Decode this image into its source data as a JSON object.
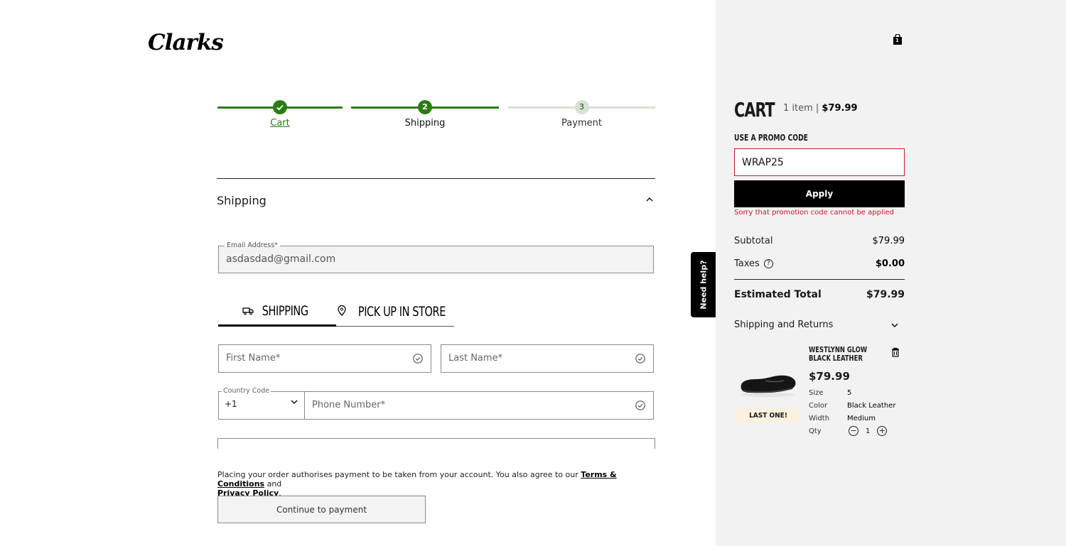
{
  "brand": {
    "logo_text": "Clarks"
  },
  "steps": [
    {
      "num": "",
      "label": "Cart",
      "state": "done"
    },
    {
      "num": "2",
      "label": "Shipping",
      "state": "current"
    },
    {
      "num": "3",
      "label": "Payment",
      "state": "pending"
    }
  ],
  "shipping_section": {
    "title": "Shipping"
  },
  "form": {
    "email": {
      "label": "Email Address*",
      "value": "asdasdad@gmail.com"
    },
    "tabs": [
      {
        "label": "SHIPPING",
        "icon": "truck-icon"
      },
      {
        "label": "PICK UP IN STORE",
        "icon": "location-pin-icon"
      }
    ],
    "first_name": {
      "placeholder": "First Name*"
    },
    "last_name": {
      "placeholder": "Last Name*"
    },
    "country_code": {
      "label": "Country Code",
      "value": "+1"
    },
    "phone": {
      "placeholder": "Phone Number*"
    }
  },
  "legal": {
    "text_before": "Placing your order authorises payment to be taken from your account. You also agree to our ",
    "terms": "Terms & Conditions",
    "text_mid": " and",
    "privacy": "Privacy Policy",
    "text_end": "."
  },
  "continue_label": "Continue to payment",
  "need_help": "Need help?",
  "cart": {
    "bag_count": "1",
    "title": "CART",
    "items_text": "1 item | ",
    "total_inline": "$79.99",
    "promo_label": "USE A PROMO CODE",
    "promo_value": "WRAP25",
    "apply_label": "Apply",
    "promo_error": "Sorry that promotion code cannot be applied",
    "subtotal_label": "Subtotal",
    "subtotal_value": "$79.99",
    "taxes_label": "Taxes",
    "taxes_value": "$0.00",
    "est_total_label": "Estimated Total",
    "est_total_value": "$79.99",
    "ship_returns_label": "Shipping and Returns"
  },
  "product": {
    "name": "WESTLYNN GLOW BLACK LEATHER",
    "price": "$79.99",
    "badge": "LAST ONE!",
    "attrs": [
      {
        "label": "Size",
        "value": "5"
      },
      {
        "label": "Color",
        "value": "Black Leather"
      },
      {
        "label": "Width",
        "value": "Medium"
      }
    ],
    "qty_label": "Qty",
    "qty_value": "1"
  },
  "colors": {
    "green": "#2a7d12",
    "error": "#c8192b",
    "cart_bg": "#f2f2f2"
  }
}
